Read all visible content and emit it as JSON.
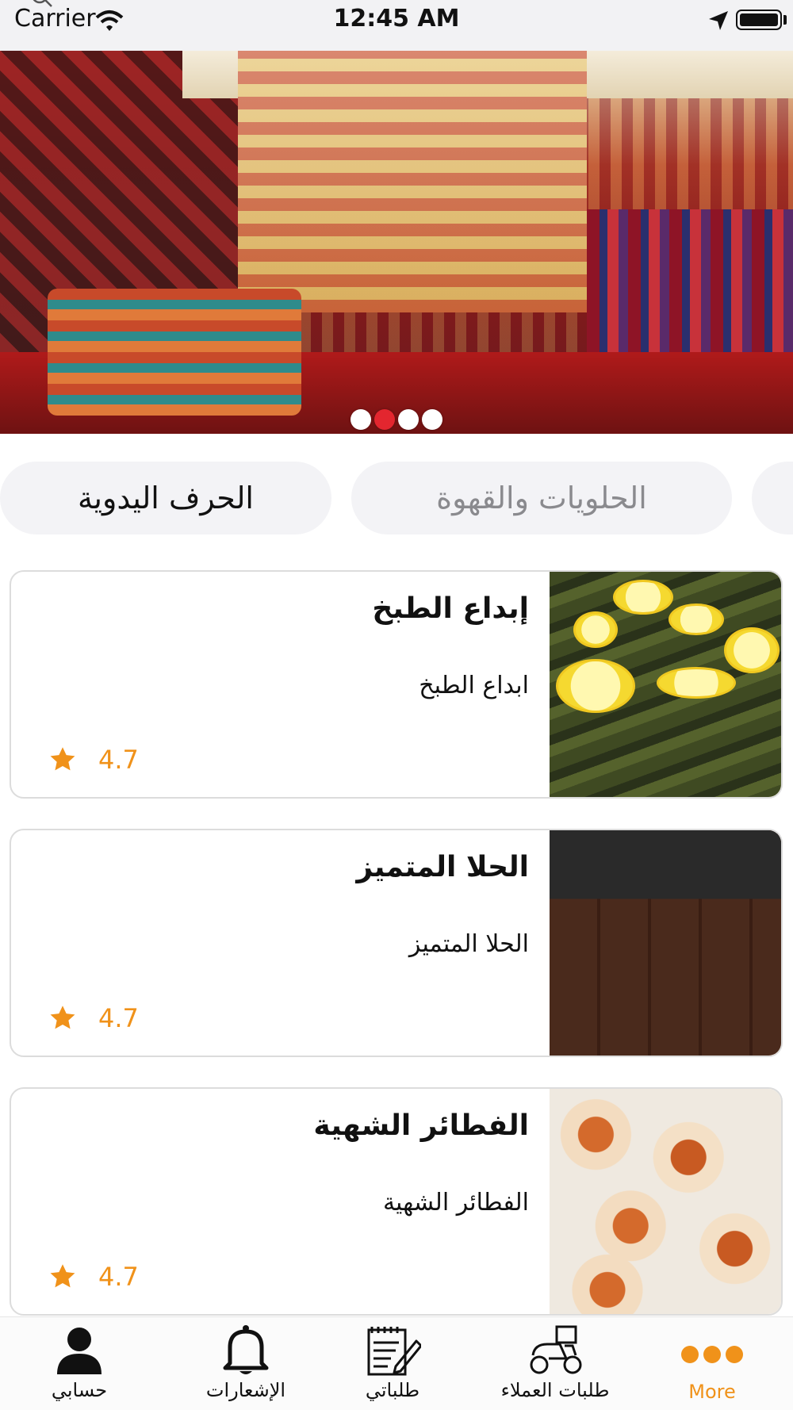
{
  "status_bar": {
    "carrier": "Carrier",
    "time": "12:45 AM",
    "wifi_icon": "wifi-icon",
    "location_icon": "location-arrow-icon",
    "battery_icon": "battery-icon",
    "battery_level": 1.0
  },
  "banner": {
    "image": "heritage-handicrafts-market-photo",
    "carousel_dots": 4,
    "active_dot_index": 1,
    "active_dot_color": "#e3262f"
  },
  "categories": [
    {
      "label": "الحرف اليدوية",
      "selected": true
    },
    {
      "label": "الحلويات والقهوة",
      "selected": false
    }
  ],
  "products": [
    {
      "title": "إبداع الطبخ",
      "subtitle": "ابداع الطبخ",
      "rating": "4.7",
      "image": "stuffed-grape-leaves-photo"
    },
    {
      "title": "الحلا المتميز",
      "subtitle": "الحلا المتميز",
      "rating": "4.7",
      "image": "chocolate-brownies-photo"
    },
    {
      "title": "الفطائر الشهية",
      "subtitle": "الفطائر الشهية",
      "rating": "4.7",
      "image": "mini-pizza-pastries-photo"
    }
  ],
  "tab_bar": {
    "account": "حسابي",
    "notifications": "الإشعارات",
    "my_orders": "طلباتي",
    "customer_orders": "طلبات العملاء",
    "more": "More"
  },
  "colors": {
    "accent": "#f0921a",
    "chip_bg": "#f3f3f6",
    "chip_inactive_text": "#8a8a8e",
    "card_border": "#dcdcdc"
  }
}
